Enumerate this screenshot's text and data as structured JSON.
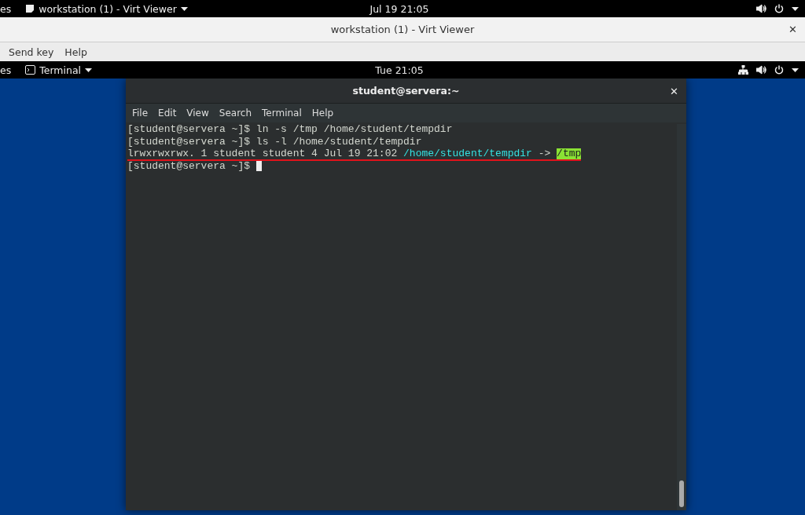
{
  "host_bar": {
    "activities": "es",
    "app": "workstation (1) - Virt Viewer",
    "clock": "Jul 19  21:05"
  },
  "viewer_window": {
    "title": "workstation (1) - Virt Viewer",
    "close": "✕",
    "menu": [
      "Send key",
      "Help"
    ]
  },
  "guest_bar": {
    "activities": "es",
    "app": "Terminal",
    "clock": "Tue 21:05"
  },
  "terminal": {
    "title": "student@servera:~",
    "close": "✕",
    "menu": [
      "File",
      "Edit",
      "View",
      "Search",
      "Terminal",
      "Help"
    ],
    "lines": [
      {
        "underlined": false,
        "cursor": false,
        "segments": [
          {
            "kind": "plain",
            "text": "[student@servera ~]$ ln -s /tmp /home/student/tempdir"
          }
        ]
      },
      {
        "underlined": false,
        "cursor": false,
        "segments": [
          {
            "kind": "plain",
            "text": "[student@servera ~]$ ls -l /home/student/tempdir"
          }
        ]
      },
      {
        "underlined": true,
        "cursor": false,
        "segments": [
          {
            "kind": "plain",
            "text": "lrwxrwxrwx. 1 student student 4 Jul 19 21:02 "
          },
          {
            "kind": "link",
            "text": "/home/student/tempdir"
          },
          {
            "kind": "plain",
            "text": " -> "
          },
          {
            "kind": "highlight",
            "text": "/tmp"
          }
        ]
      },
      {
        "underlined": false,
        "cursor": true,
        "segments": [
          {
            "kind": "plain",
            "text": "[student@servera ~]$ "
          }
        ]
      }
    ]
  }
}
